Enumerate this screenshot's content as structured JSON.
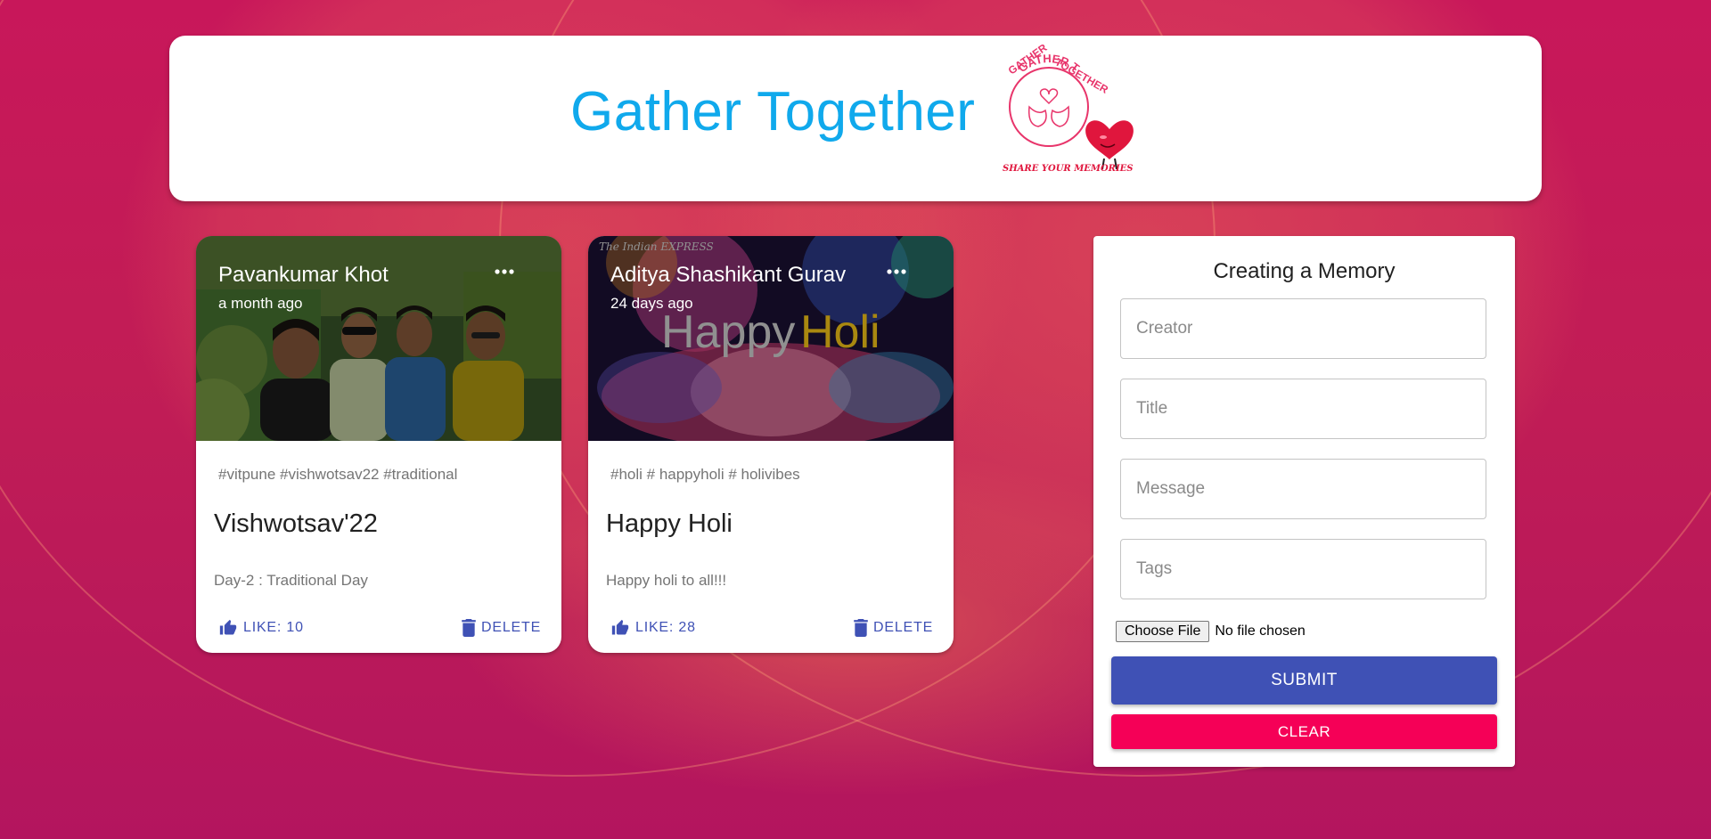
{
  "app": {
    "title": "Gather Together",
    "logo_text_top": "GATHER TOGETHER",
    "logo_text_bottom": "SHARE YOUR MEMORIES"
  },
  "posts": [
    {
      "creator": "Pavankumar Khot",
      "time": "a month ago",
      "tags": "#vitpune #vishwotsav22 #traditional",
      "title": "Vishwotsav'22",
      "message": "Day-2 : Traditional Day",
      "like_label": "LIKE: 10",
      "delete_label": "DELETE",
      "image": "group-photo-garden"
    },
    {
      "creator": "Aditya Shashikant Gurav",
      "time": "24 days ago",
      "tags": "#holi # happyholi # holivibes",
      "title": "Happy Holi",
      "message": "Happy holi to all!!!",
      "like_label": "LIKE: 28",
      "delete_label": "DELETE",
      "image_caption": "The Indian EXPRESS",
      "image_text_a": "Happy",
      "image_text_b": "Holi",
      "image": "happy-holi-banner"
    }
  ],
  "form": {
    "title": "Creating a Memory",
    "creator_placeholder": "Creator",
    "title_placeholder": "Title",
    "message_placeholder": "Message",
    "tags_placeholder": "Tags",
    "file_button": "Choose File",
    "file_status": "No file chosen",
    "submit_label": "SUBMIT",
    "clear_label": "CLEAR"
  },
  "colors": {
    "background": "#c2185b",
    "title": "#10a9ec",
    "primary": "#3f51b5",
    "secondary": "#f50057"
  }
}
